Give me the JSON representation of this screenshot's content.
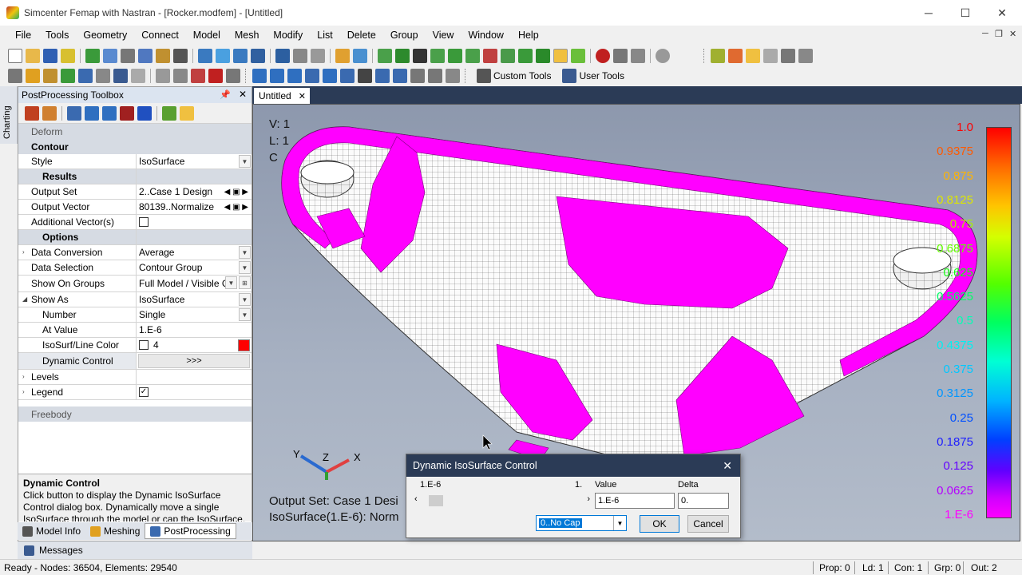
{
  "window": {
    "title": "Simcenter Femap with Nastran - [Rocker.modfem] - [Untitled]",
    "minimize": "─",
    "maximize": "☐",
    "close": "✕"
  },
  "menu": [
    "File",
    "Tools",
    "Geometry",
    "Connect",
    "Model",
    "Mesh",
    "Modify",
    "List",
    "Delete",
    "Group",
    "View",
    "Window",
    "Help"
  ],
  "toolbar2": {
    "custom_tools": "Custom Tools",
    "user_tools": "User Tools"
  },
  "side_tab": "Charting",
  "toolbox": {
    "title": "PostProcessing Toolbox",
    "sections": {
      "deform": "Deform",
      "contour": "Contour",
      "results": "Results",
      "options": "Options",
      "freebody": "Freebody"
    },
    "rows": {
      "style": {
        "label": "Style",
        "value": "IsoSurface"
      },
      "output_set": {
        "label": "Output Set",
        "value": "2..Case 1 Design"
      },
      "output_vector": {
        "label": "Output Vector",
        "value": "80139..Normalize"
      },
      "additional_vectors": {
        "label": "Additional Vector(s)"
      },
      "data_conversion": {
        "label": "Data Conversion",
        "value": "Average"
      },
      "data_selection": {
        "label": "Data Selection",
        "value": "Contour Group"
      },
      "show_on_groups": {
        "label": "Show On Groups",
        "value": "Full Model / Visible G"
      },
      "show_as": {
        "label": "Show As",
        "value": "IsoSurface"
      },
      "number": {
        "label": "Number",
        "value": "Single"
      },
      "at_value": {
        "label": "At Value",
        "value": "1.E-6"
      },
      "isosurf_color": {
        "label": "IsoSurf/Line Color",
        "value": "4"
      },
      "dynamic_control": {
        "label": "Dynamic Control",
        "value": ">>>"
      },
      "levels": {
        "label": "Levels"
      },
      "legend": {
        "label": "Legend"
      }
    },
    "help": {
      "title": "Dynamic Control",
      "text": "Click button to display the Dynamic IsoSurface Control dialog box. Dynamically move a single IsoSurface through the model or cap the IsoSurface."
    }
  },
  "bottom_tabs": [
    "Model Info",
    "Meshing",
    "PostProcessing"
  ],
  "messages_tab": "Messages",
  "doc_tab": "Untitled",
  "viewport": {
    "corner": [
      "V: 1",
      "L: 1",
      "C"
    ],
    "output_text": [
      "Output Set: Case 1 Desi",
      "IsoSurface(1.E-6): Norm"
    ],
    "triad": {
      "x": "X",
      "y": "Y",
      "z": "Z"
    },
    "legend": [
      "1.0",
      "0.9375",
      "0.875",
      "0.8125",
      "0.75",
      "0.6875",
      "0.625",
      "0.5625",
      "0.5",
      "0.4375",
      "0.375",
      "0.3125",
      "0.25",
      "0.1875",
      "0.125",
      "0.0625",
      "1.E-6"
    ],
    "legend_colors": [
      "#ff0000",
      "#ff5a00",
      "#ffb400",
      "#dce600",
      "#a8f000",
      "#64ff00",
      "#14ff14",
      "#00ff64",
      "#00ffb4",
      "#00f0f0",
      "#00c8ff",
      "#0096ff",
      "#0050ff",
      "#1e1eff",
      "#6400ff",
      "#b400ff",
      "#ff00ff"
    ]
  },
  "dialog": {
    "title": "Dynamic IsoSurface Control",
    "min_value": "1.E-6",
    "max_value": "1.",
    "value_label": "Value",
    "delta_label": "Delta",
    "value": "1.E-6",
    "delta": "0.",
    "cap_option": "0..No Cap",
    "ok": "OK",
    "cancel": "Cancel"
  },
  "status": {
    "ready": "Ready - Nodes: 36504,  Elements: 29540",
    "prop": "Prop: 0",
    "ld": "Ld: 1",
    "con": "Con: 1",
    "grp": "Grp: 0",
    "out": "Out: 2"
  }
}
